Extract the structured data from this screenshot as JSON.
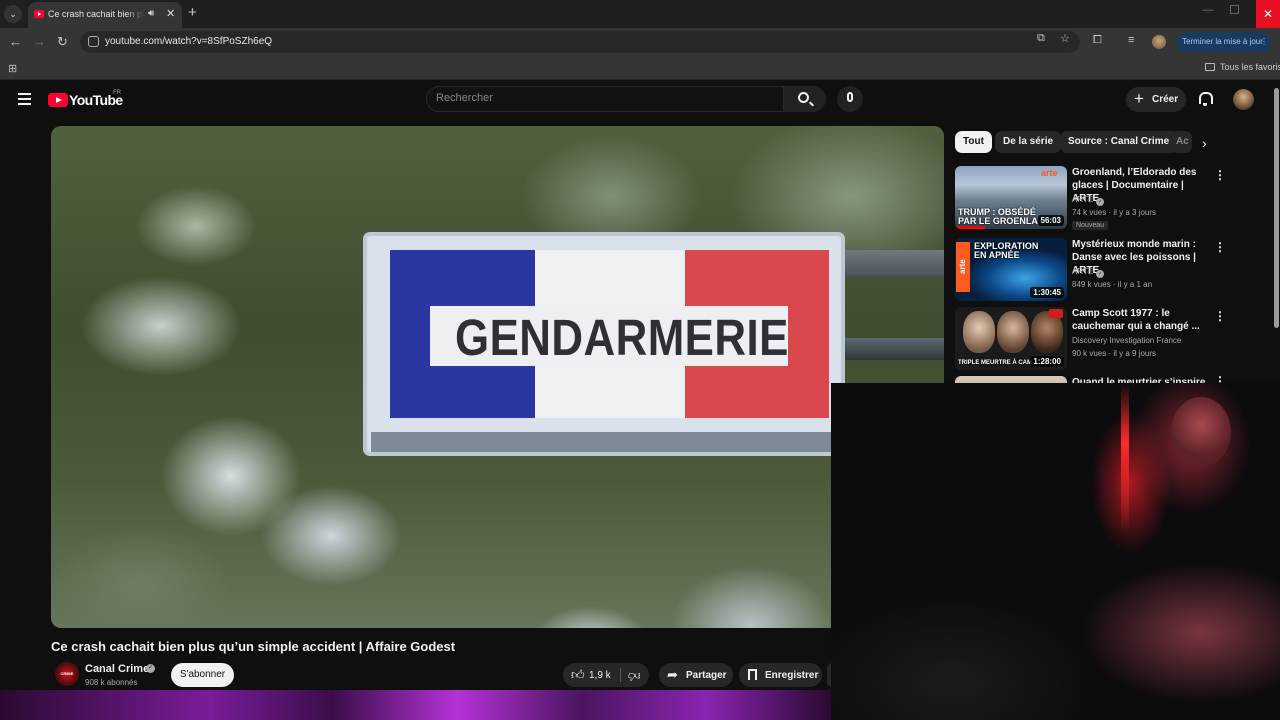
{
  "browser": {
    "tab_title": "Ce crash cachait bien plus qu'un simple accident",
    "url": "youtube.com/watch?v=8SfPoSZh6eQ",
    "update_button": "Terminer la mise à jour",
    "bookmarks_all": "Tous les favoris",
    "accent_color": "#1c3a5c"
  },
  "masthead": {
    "logo_text": "YouTube",
    "country": "FR",
    "search_placeholder": "Rechercher",
    "create_label": "Créer"
  },
  "player": {
    "sign_text": "GENDARMERIE"
  },
  "video": {
    "title": "Ce crash cachait bien plus qu’un simple accident | Affaire Godest",
    "channel": "Canal Crime",
    "channel_avatar_text": "CRIME",
    "subscribers": "908 k abonnés",
    "subscribe_label": "S'abonner",
    "likes": "1,9 k",
    "share_label": "Partager",
    "save_label": "Enregistrer"
  },
  "chips": {
    "all": "Tout",
    "series": "De la série",
    "source": "Source : Canal Crime",
    "more": "Ac"
  },
  "recommendations": [
    {
      "title": "Groenland, l’Eldorado des glaces | Documentaire | ARTE",
      "channel": "ARTE",
      "meta": "74 k vues · il y a 3 jours",
      "badge": "Nouveau",
      "duration": "56:03",
      "thumb_caption_1": "TRUMP : OBSÉDÉ",
      "thumb_caption_2": "PAR LE GROENLA",
      "thumb_brand": "arte"
    },
    {
      "title": "Mystérieux monde marin : Danse avec les poissons | ARTE",
      "channel": "ARTE",
      "meta": "849 k vues · il y a 1 an",
      "duration": "1:30:45",
      "thumb_caption_1": "EXPLORATION",
      "thumb_caption_2": "EN APNÉE",
      "thumb_brand": "arte"
    },
    {
      "title": "Camp Scott 1977 : le cauchemar qui a changé ...",
      "channel": "Discovery Investigation France",
      "meta": "90 k vues · il y a 9 jours",
      "duration": "1:28:00",
      "thumb_caption_1": "TRIPLE MEURTRE À CAM"
    },
    {
      "title": "Quand le meurtrier s’inspire de"
    }
  ]
}
